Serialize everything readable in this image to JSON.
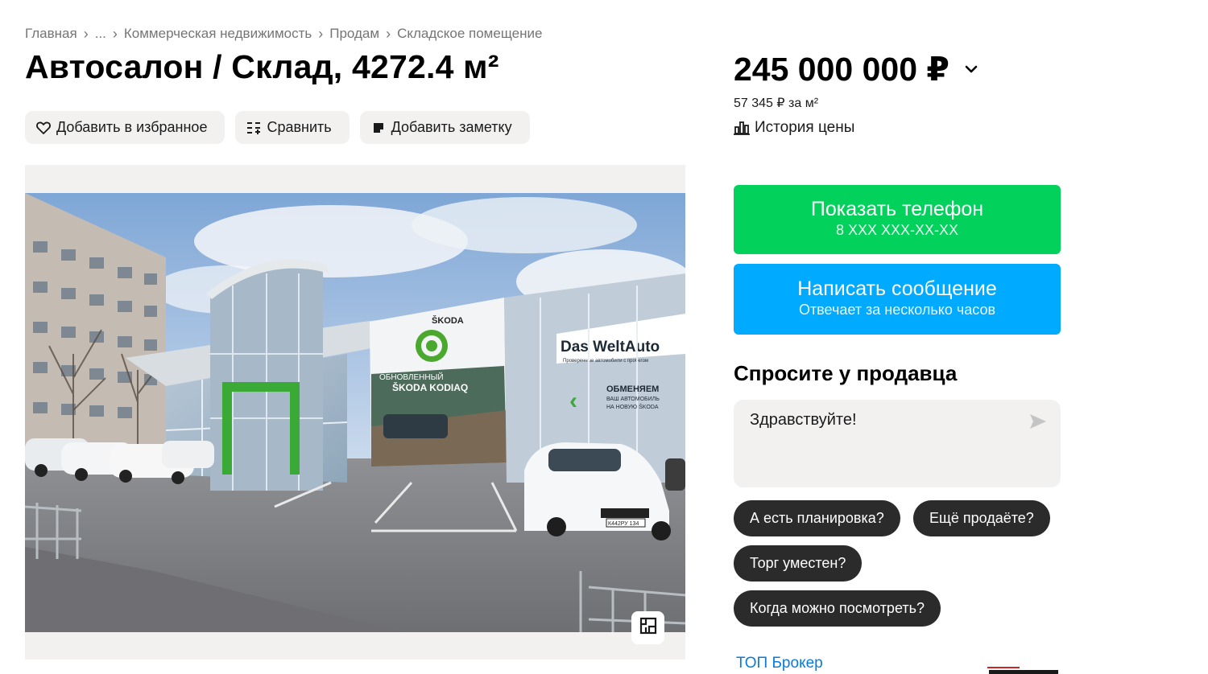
{
  "breadcrumb": {
    "home": "Главная",
    "ellipsis": "...",
    "commercial": "Коммерческая недвижимость",
    "sell": "Продам",
    "warehouse": "Складское помещение"
  },
  "title": "Автосалон / Склад, 4272.4 м²",
  "actions": {
    "favorite": "Добавить в избранное",
    "compare": "Сравнить",
    "note": "Добавить заметку"
  },
  "price": {
    "value": "245 000 000 ₽",
    "per_m2": "57 345 ₽ за м²",
    "history": "История цены"
  },
  "contact": {
    "phone_label": "Показать телефон",
    "phone_masked": "8 XXX XXX-XX-XX",
    "message_label": "Написать сообщение",
    "message_sub": "Отвечает за несколько часов"
  },
  "ask": {
    "title": "Спросите у продавца",
    "message": "Здравствуйте!",
    "chips": [
      "А есть планировка?",
      "Ещё продаёте?",
      "Торг уместен?",
      "Когда можно посмотреть?"
    ]
  },
  "seller": {
    "badge": "ТОП Брокер"
  },
  "photo": {
    "signs": {
      "brand": "ŠKODA",
      "banner_line1": "ОБНОВЛЕННЫЙ",
      "banner_line2": "ŠKODA KODIAQ",
      "dealer": "Das WeltAuto",
      "dealer_sub": "Проверенные автомобили с пробегом",
      "exchange_title": "ОБМЕНЯЕМ",
      "exchange_line1": "ВАШ АВТОМОБИЛЬ",
      "exchange_line2": "НА НОВУЮ ŠKODA",
      "plate": "К442РУ 134"
    }
  },
  "colors": {
    "green_cta": "#02d15c",
    "blue_cta": "#00aaff",
    "chip_bg": "#2b2b2b",
    "muted_bg": "#f2f1f0",
    "link": "#0a7bdb"
  }
}
